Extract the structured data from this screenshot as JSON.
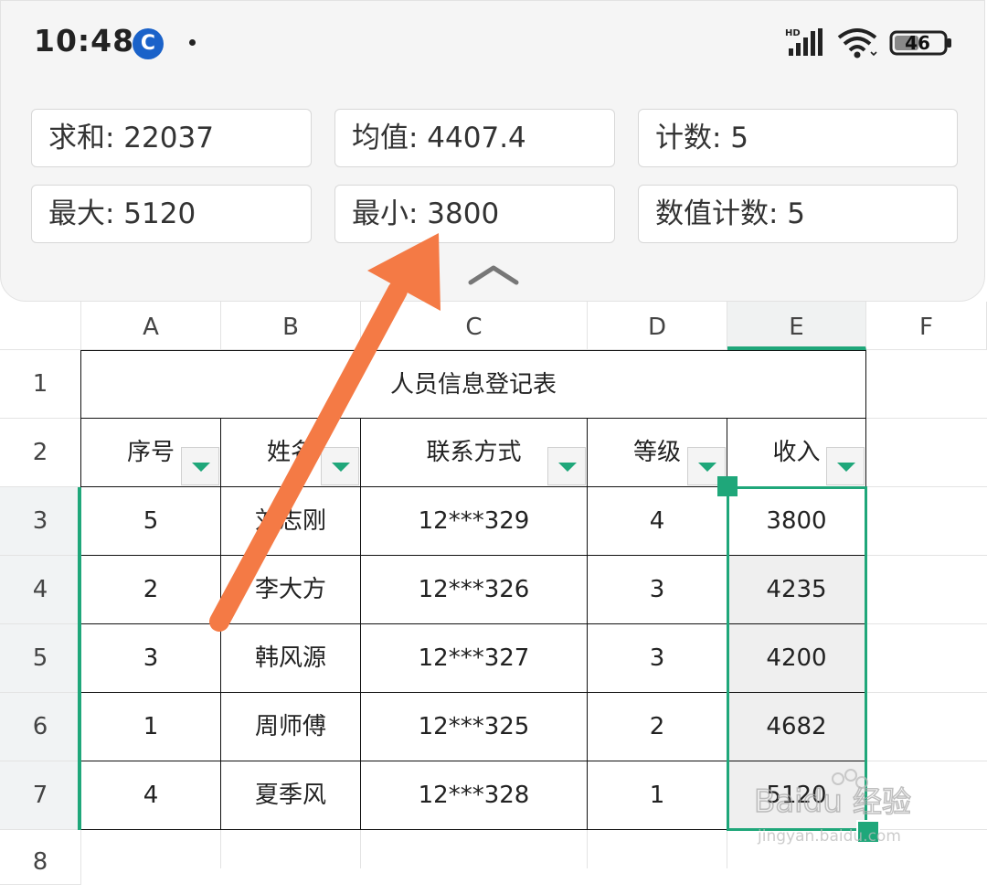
{
  "status_bar": {
    "time": "10:48",
    "icons": [
      "app-icon",
      "notification-dot-icon",
      "hd-signal-icon",
      "wifi-icon",
      "battery-icon"
    ],
    "battery": "46"
  },
  "stats": {
    "sum": "求和: 22037",
    "mean": "均值: 4407.4",
    "count": "计数: 5",
    "max": "最大: 5120",
    "min": "最小: 3800",
    "num_count": "数值计数: 5"
  },
  "columns": [
    "A",
    "B",
    "C",
    "D",
    "E",
    "F"
  ],
  "rows": [
    "1",
    "2",
    "3",
    "4",
    "5",
    "6",
    "7",
    "8"
  ],
  "sheet": {
    "title": "人员信息登记表",
    "headers": [
      "序号",
      "姓名",
      "联系方式",
      "等级",
      "收入"
    ],
    "data": [
      [
        "5",
        "刘志刚",
        "12***329",
        "4",
        "3800"
      ],
      [
        "2",
        "李大方",
        "12***326",
        "3",
        "4235"
      ],
      [
        "3",
        "韩风源",
        "12***327",
        "3",
        "4200"
      ],
      [
        "1",
        "周师傅",
        "12***325",
        "2",
        "4682"
      ],
      [
        "4",
        "夏季风",
        "12***328",
        "1",
        "5120"
      ]
    ]
  },
  "colors": {
    "accent": "#1fa77a",
    "arrow": "#f47a45",
    "icon_blue": "#1a62c9"
  },
  "watermark": {
    "brand": "Baidu",
    "cn": "经验",
    "url": "jingyan.baidu.com"
  }
}
